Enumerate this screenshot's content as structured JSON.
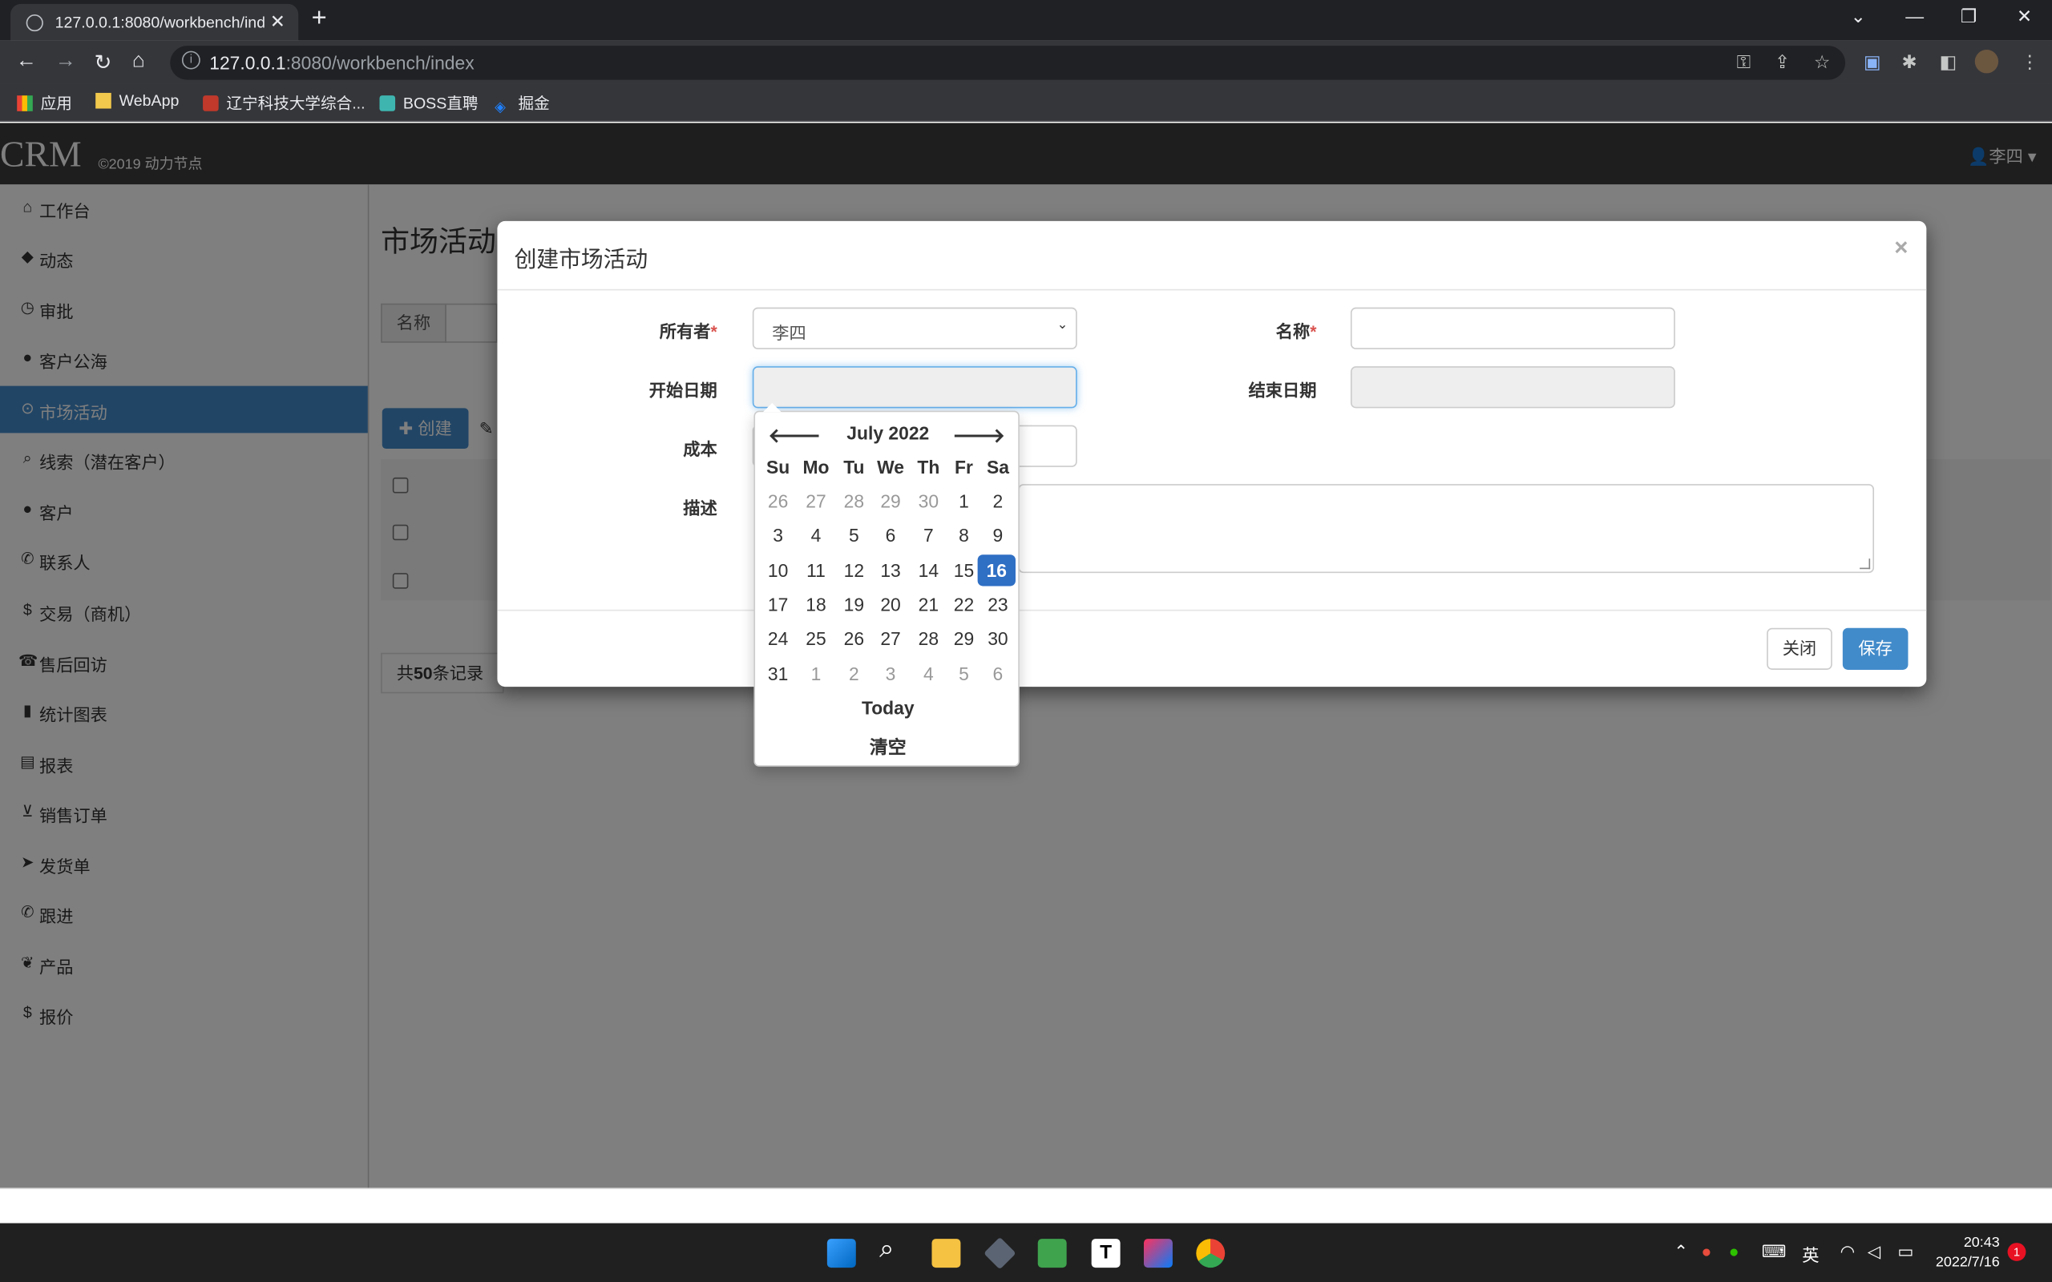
{
  "browser": {
    "tab_title": "127.0.0.1:8080/workbench/index",
    "url_host": "127.0.0.1",
    "url_rest": ":8080/workbench/index",
    "bookmarks": [
      "应用",
      "WebApp",
      "辽宁科技大学综合...",
      "BOSS直聘",
      "掘金"
    ]
  },
  "app": {
    "brand": "CRM",
    "brand_sub": "©2019 动力节点",
    "user": "李四"
  },
  "sidebar": {
    "items": [
      {
        "label": "工作台",
        "icon": "home-icon"
      },
      {
        "label": "动态",
        "icon": "tag-icon"
      },
      {
        "label": "审批",
        "icon": "clock-icon"
      },
      {
        "label": "客户公海",
        "icon": "user-icon"
      },
      {
        "label": "市场活动",
        "icon": "play-circle-icon"
      },
      {
        "label": "线索（潜在客户）",
        "icon": "search-icon"
      },
      {
        "label": "客户",
        "icon": "user-icon"
      },
      {
        "label": "联系人",
        "icon": "phone-icon"
      },
      {
        "label": "交易（商机）",
        "icon": "dollar-icon"
      },
      {
        "label": "售后回访",
        "icon": "phone-alt-icon"
      },
      {
        "label": "统计图表",
        "icon": "stats-icon"
      },
      {
        "label": "报表",
        "icon": "file-icon"
      },
      {
        "label": "销售订单",
        "icon": "cart-icon"
      },
      {
        "label": "发货单",
        "icon": "send-icon"
      },
      {
        "label": "跟进",
        "icon": "phone-icon"
      },
      {
        "label": "产品",
        "icon": "leaf-icon"
      },
      {
        "label": "报价",
        "icon": "dollar-icon"
      }
    ]
  },
  "main": {
    "title": "市场活动",
    "search_label": "名称",
    "create_label": "创建",
    "pager_prefix": "共",
    "pager_count": "50",
    "pager_suffix": "条记录"
  },
  "modal": {
    "title": "创建市场活动",
    "owner_label": "所有者",
    "owner_value": "李四",
    "name_label": "名称",
    "start_label": "开始日期",
    "end_label": "结束日期",
    "cost_label": "成本",
    "desc_label": "描述",
    "close_label": "关闭",
    "save_label": "保存"
  },
  "datepicker": {
    "title": "July 2022",
    "dow": [
      "Su",
      "Mo",
      "Tu",
      "We",
      "Th",
      "Fr",
      "Sa"
    ],
    "weeks": [
      [
        "26",
        "27",
        "28",
        "29",
        "30",
        "1",
        "2"
      ],
      [
        "3",
        "4",
        "5",
        "6",
        "7",
        "8",
        "9"
      ],
      [
        "10",
        "11",
        "12",
        "13",
        "14",
        "15",
        "16"
      ],
      [
        "17",
        "18",
        "19",
        "20",
        "21",
        "22",
        "23"
      ],
      [
        "24",
        "25",
        "26",
        "27",
        "28",
        "29",
        "30"
      ],
      [
        "31",
        "1",
        "2",
        "3",
        "4",
        "5",
        "6"
      ]
    ],
    "selected": "16",
    "today_label": "Today",
    "clear_label": "清空"
  },
  "taskbar": {
    "ime": "英",
    "time": "20:43",
    "date": "2022/7/16",
    "notifications": "1"
  }
}
